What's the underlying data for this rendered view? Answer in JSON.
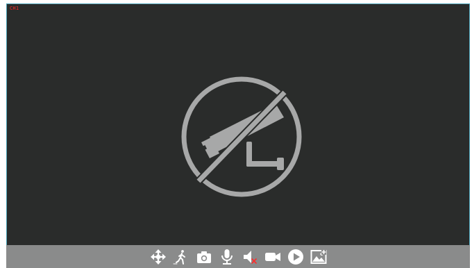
{
  "viewer": {
    "channel_label": "CH1",
    "status_icon": "no-camera-icon",
    "colors": {
      "background": "#2a2c2b",
      "toolbar": "#8a8b8b",
      "icon": "#ffffff",
      "placeholder_icon": "#a7a8a8",
      "accent_red": "#ff2b2b",
      "border": "#4aa3b8"
    }
  },
  "toolbar": {
    "buttons": [
      {
        "name": "ptz-control",
        "icon": "move-arrows-icon"
      },
      {
        "name": "motion-detection",
        "icon": "walking-person-icon"
      },
      {
        "name": "snapshot",
        "icon": "camera-icon"
      },
      {
        "name": "talk",
        "icon": "microphone-icon"
      },
      {
        "name": "audio-muted",
        "icon": "speaker-muted-icon"
      },
      {
        "name": "record",
        "icon": "video-camera-icon"
      },
      {
        "name": "playback",
        "icon": "play-circle-icon"
      },
      {
        "name": "gallery",
        "icon": "image-gallery-icon"
      }
    ]
  }
}
